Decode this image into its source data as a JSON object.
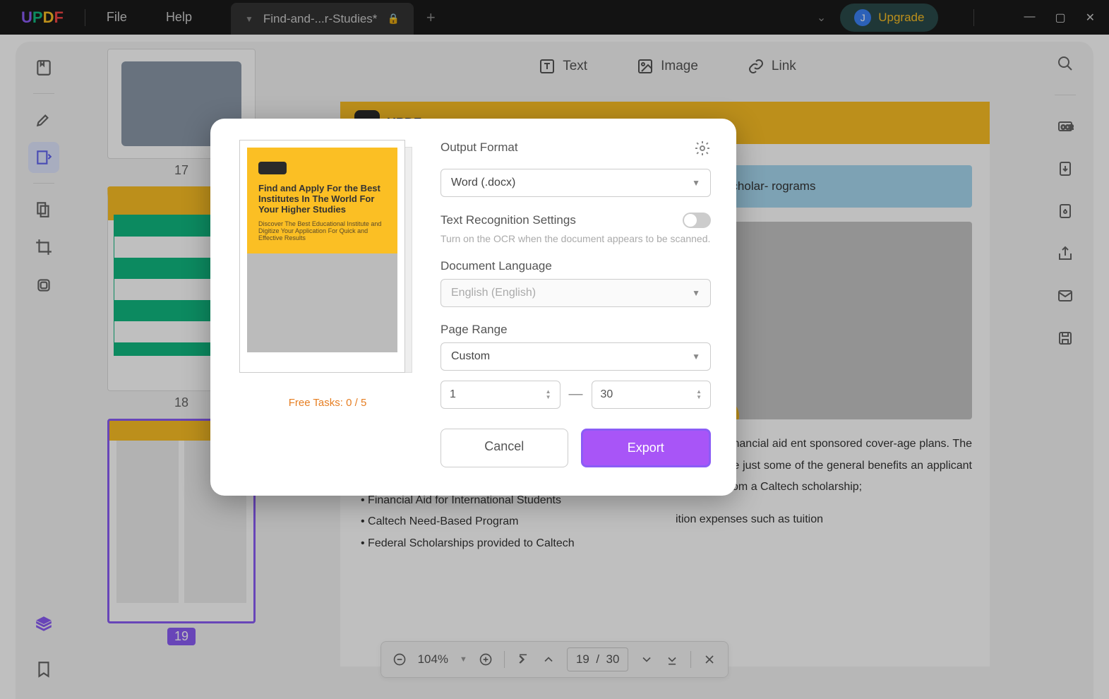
{
  "titlebar": {
    "logo_u": "U",
    "logo_p": "P",
    "logo_d": "D",
    "logo_f": "F",
    "menu_file": "File",
    "menu_help": "Help",
    "tab_title": "Find-and-...r-Studies*",
    "avatar_initial": "J",
    "upgrade": "Upgrade"
  },
  "thumbs": {
    "p17": "17",
    "p18": "18",
    "p19": "19"
  },
  "tools": {
    "text": "Text",
    "image": "Image",
    "link": "Link"
  },
  "doc": {
    "brand": "UPDF",
    "highlight": "altech Scholar- rograms",
    "col1_b1": "• Financial Aid for International Students",
    "col1_b2": "• Caltech Need-Based Program",
    "col1_b3": "• Federal Scholarships provided to Caltech",
    "col2_p1": "ships and financial aid ent sponsored cover-age plans. The following are just some of the general benefits an applicant might get from a Caltech scholarship;",
    "col2_p2": "ition expenses such as tuition"
  },
  "bottombar": {
    "zoom": "104%",
    "page_current": "19",
    "page_sep": "/",
    "page_total": "30"
  },
  "modal": {
    "preview_title": "Find and Apply For the Best Institutes In The World For Your Higher Studies",
    "preview_sub": "Discover The Best Educational Institute and Digitize Your Application For Quick and Effective Results",
    "free_tasks": "Free Tasks: 0 / 5",
    "output_format_label": "Output Format",
    "output_format_value": "Word (.docx)",
    "ocr_label": "Text Recognition Settings",
    "ocr_hint": "Turn on the OCR when the document appears to be scanned.",
    "lang_label": "Document Language",
    "lang_value": "English (English)",
    "range_label": "Page Range",
    "range_value": "Custom",
    "range_from": "1",
    "range_to": "30",
    "cancel": "Cancel",
    "export": "Export"
  }
}
